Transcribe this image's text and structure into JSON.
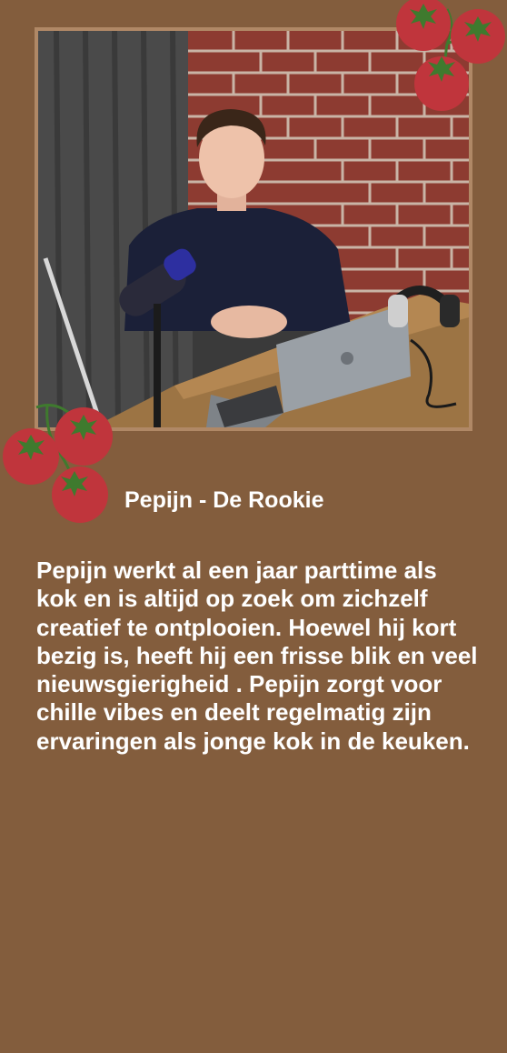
{
  "profile": {
    "name": "Pepijn - De Rookie",
    "bio": "Pepijn werkt al een jaar parttime als kok en is altijd op zoek om zichzelf creatief te ontplooien. Hoewel hij kort bezig is, heeft hij een frisse blik en veel nieuwsgierigheid . Pepijn zorgt voor chille vibes en deelt regelmatig zijn ervaringen als jonge kok in de keuken."
  },
  "colors": {
    "background": "#835d3d",
    "frame": "#b08866",
    "tomato": "#c0353c",
    "stem": "#3f7a2e",
    "text": "#ffffff"
  },
  "icons": {
    "decoration_top": "tomato-cluster-icon",
    "decoration_left": "tomato-cluster-icon"
  }
}
